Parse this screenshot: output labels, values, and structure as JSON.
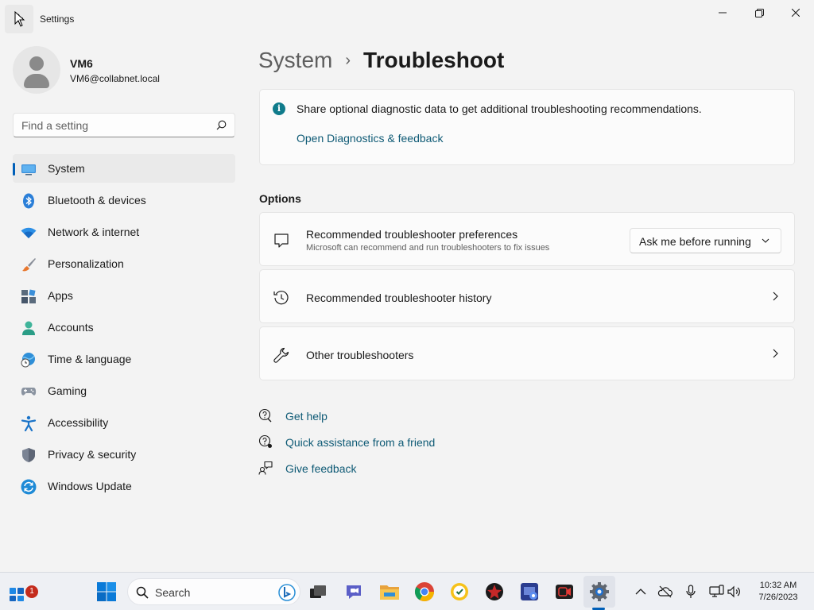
{
  "window": {
    "title": "Settings"
  },
  "profile": {
    "name": "VM6",
    "email": "VM6@collabnet.local"
  },
  "search": {
    "placeholder": "Find a setting"
  },
  "sidebar": {
    "items": [
      {
        "label": "System",
        "icon": "monitor-icon",
        "active": true
      },
      {
        "label": "Bluetooth & devices",
        "icon": "bluetooth-icon"
      },
      {
        "label": "Network & internet",
        "icon": "wifi-icon"
      },
      {
        "label": "Personalization",
        "icon": "paintbrush-icon"
      },
      {
        "label": "Apps",
        "icon": "apps-icon"
      },
      {
        "label": "Accounts",
        "icon": "person-icon"
      },
      {
        "label": "Time & language",
        "icon": "globe-clock-icon"
      },
      {
        "label": "Gaming",
        "icon": "gamepad-icon"
      },
      {
        "label": "Accessibility",
        "icon": "accessibility-icon"
      },
      {
        "label": "Privacy & security",
        "icon": "shield-icon"
      },
      {
        "label": "Windows Update",
        "icon": "update-icon"
      }
    ]
  },
  "breadcrumb": {
    "parent": "System",
    "separator": "›",
    "current": "Troubleshoot"
  },
  "info_card": {
    "text": "Share optional diagnostic data to get additional troubleshooting recommendations.",
    "link": "Open Diagnostics & feedback"
  },
  "options": {
    "header": "Options",
    "preferences": {
      "title": "Recommended troubleshooter preferences",
      "subtitle": "Microsoft can recommend and run troubleshooters to fix issues",
      "dropdown_value": "Ask me before running"
    },
    "history": {
      "title": "Recommended troubleshooter history"
    },
    "other": {
      "title": "Other troubleshooters"
    }
  },
  "help_links": [
    {
      "label": "Get help",
      "icon": "help-icon"
    },
    {
      "label": "Quick assistance from a friend",
      "icon": "quick-assist-icon"
    },
    {
      "label": "Give feedback",
      "icon": "feedback-icon"
    }
  ],
  "taskbar": {
    "search_label": "Search",
    "widgets_badge": "1",
    "time": "10:32 AM",
    "date": "7/26/2023"
  },
  "colors": {
    "accent": "#005fb8",
    "link": "#0e5a75",
    "info": "#0f7b8b",
    "badge": "#c42b1c"
  }
}
